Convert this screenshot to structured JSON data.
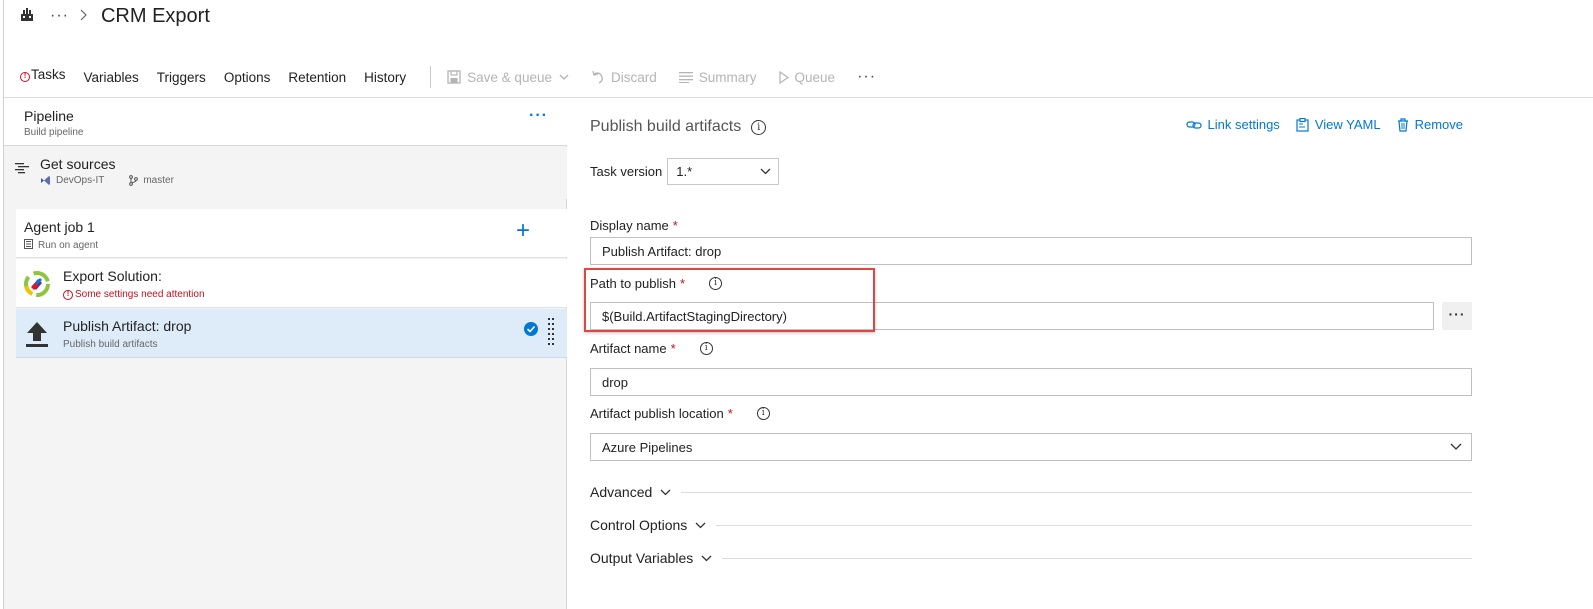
{
  "breadcrumb": {
    "more": "···",
    "title": "CRM Export"
  },
  "tabs": [
    {
      "label": "Tasks",
      "active": true,
      "warning": true
    },
    {
      "label": "Variables"
    },
    {
      "label": "Triggers"
    },
    {
      "label": "Options"
    },
    {
      "label": "Retention"
    },
    {
      "label": "History"
    }
  ],
  "commands": {
    "save_queue": "Save & queue",
    "discard": "Discard",
    "summary": "Summary",
    "queue": "Queue",
    "more": "···"
  },
  "pipeline": {
    "title": "Pipeline",
    "subtitle": "Build pipeline",
    "more": "···"
  },
  "sources": {
    "title": "Get sources",
    "repo": "DevOps-IT",
    "branch": "master"
  },
  "agent_job": {
    "title": "Agent job 1",
    "subtitle": "Run on agent",
    "add": "+"
  },
  "tasks_list": [
    {
      "title": "Export Solution:",
      "subtitle": "Some settings need attention",
      "warning": true
    },
    {
      "title": "Publish Artifact: drop",
      "subtitle": "Publish build artifacts",
      "selected": true
    }
  ],
  "details": {
    "title": "Publish build artifacts",
    "actions": {
      "link_settings": "Link settings",
      "view_yaml": "View YAML",
      "remove": "Remove"
    },
    "task_version_label": "Task version",
    "task_version_value": "1.*",
    "display_name_label": "Display name",
    "display_name_value": "Publish Artifact: drop",
    "path_label": "Path to publish",
    "path_value": "$(Build.ArtifactStagingDirectory)",
    "path_browse": "···",
    "artifact_name_label": "Artifact name",
    "artifact_name_value": "drop",
    "publish_location_label": "Artifact publish location",
    "publish_location_value": "Azure Pipelines",
    "required_mark": "*",
    "sections": [
      "Advanced",
      "Control Options",
      "Output Variables"
    ]
  },
  "colors": {
    "accent": "#0078d4",
    "error": "#c50f1f",
    "highlight": "#e04545",
    "selected_bg": "#deecf9"
  }
}
